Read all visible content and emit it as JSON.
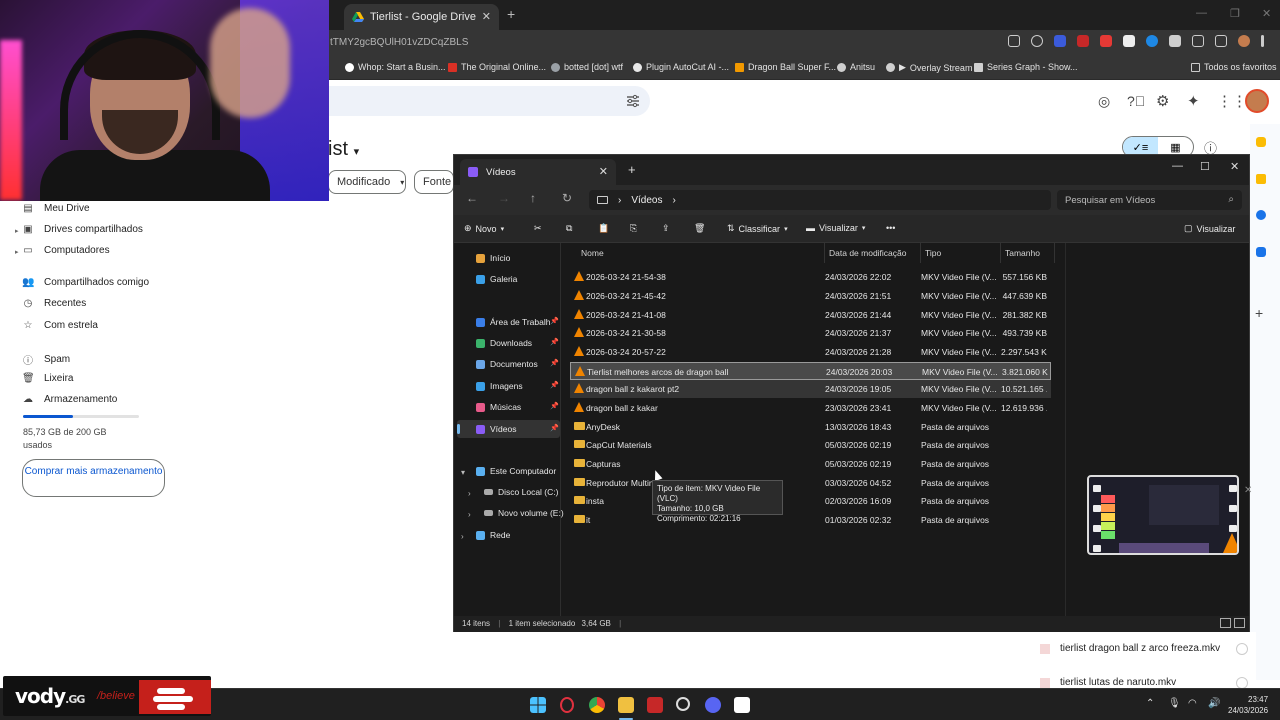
{
  "browser": {
    "tab_title": "Tierlist - Google Drive",
    "url": "tTMY2gcBQUlH01vZDCqZBLS",
    "bookmarks": [
      {
        "label": "Whop: Start a Busin...",
        "color": "#ffffff"
      },
      {
        "label": "The Original Online...",
        "color": "#d93025"
      },
      {
        "label": "botted [dot] wtf",
        "color": "#9aa0a6"
      },
      {
        "label": "Plugin AutoCut AI -...",
        "color": "#e8e8e8"
      },
      {
        "label": "Dragon Ball Super F...",
        "color": "#f29900"
      },
      {
        "label": "Anitsu",
        "color": "#cfcfcf"
      },
      {
        "label": "Overlay Stream",
        "color": "#cfcfcf"
      },
      {
        "label": "Series Graph - Show...",
        "color": "#cfcfcf"
      }
    ],
    "favorites_label": "Todos os favoritos"
  },
  "drive": {
    "heading_fragment": "ist",
    "filters": {
      "modified": "Modificado",
      "source": "Fonte"
    },
    "sidebar": [
      {
        "label": "Meu Drive",
        "icon": "drive-icon",
        "expand": true
      },
      {
        "label": "Drives compartilhados",
        "icon": "shared-drives-icon",
        "expand": true
      },
      {
        "label": "Computadores",
        "icon": "computer-icon",
        "expand": true
      },
      {
        "label": "Compartilhados comigo",
        "icon": "people-icon",
        "expand": false
      },
      {
        "label": "Recentes",
        "icon": "clock-icon",
        "expand": false
      },
      {
        "label": "Com estrela",
        "icon": "star-icon",
        "expand": false
      },
      {
        "label": "Spam",
        "icon": "spam-icon",
        "expand": false
      },
      {
        "label": "Lixeira",
        "icon": "trash-icon",
        "expand": false
      },
      {
        "label": "Armazenamento",
        "icon": "cloud-icon",
        "expand": false
      }
    ],
    "storage": {
      "text": "85,73 GB de 200 GB usados",
      "fraction": 0.43
    },
    "buy_button": "Comprar mais armazenamento",
    "uploads": [
      "tierlist dragon ball z arco freeza.mkv",
      "tierlist lutas de naruto.mkv"
    ]
  },
  "explorer": {
    "tab_title": "Vídeos",
    "breadcrumb": "Vídeos",
    "search_placeholder": "Pesquisar em Vídeos",
    "commands": {
      "new": "Novo",
      "sort": "Classificar",
      "view": "Visualizar",
      "details": "Visualizar"
    },
    "nav": [
      {
        "label": "Início",
        "color": "#e6a23c"
      },
      {
        "label": "Galeria",
        "color": "#3aa0e8"
      },
      {
        "label": "Área de Trabalho",
        "color": "#3a7ee8",
        "pinned": true
      },
      {
        "label": "Downloads",
        "color": "#3bb36b",
        "pinned": true
      },
      {
        "label": "Documentos",
        "color": "#6aa6e8",
        "pinned": true
      },
      {
        "label": "Imagens",
        "color": "#3aa0e8",
        "pinned": true
      },
      {
        "label": "Músicas",
        "color": "#e85a8a",
        "pinned": true
      },
      {
        "label": "Vídeos",
        "color": "#8a5cf6",
        "pinned": true
      },
      {
        "label": "Este Computador",
        "color": "#5ab0f0"
      },
      {
        "label": "Disco Local (C:)",
        "color": "#aaaaaa"
      },
      {
        "label": "Novo volume (E:)",
        "color": "#aaaaaa"
      },
      {
        "label": "Rede",
        "color": "#5ab0f0"
      }
    ],
    "columns": {
      "name": "Nome",
      "modified": "Data de modificação",
      "type": "Tipo",
      "size": "Tamanho"
    },
    "files": [
      {
        "name": "2026-03-24 21-54-38",
        "date": "24/03/2026 22:02",
        "type": "MKV Video File (V...",
        "size": "557.156 KB",
        "kind": "video"
      },
      {
        "name": "2026-03-24 21-45-42",
        "date": "24/03/2026 21:51",
        "type": "MKV Video File (V...",
        "size": "447.639 KB",
        "kind": "video"
      },
      {
        "name": "2026-03-24 21-41-08",
        "date": "24/03/2026 21:44",
        "type": "MKV Video File (V...",
        "size": "281.382 KB",
        "kind": "video"
      },
      {
        "name": "2026-03-24 21-30-58",
        "date": "24/03/2026 21:37",
        "type": "MKV Video File (V...",
        "size": "493.739 KB",
        "kind": "video"
      },
      {
        "name": "2026-03-24 20-57-22",
        "date": "24/03/2026 21:28",
        "type": "MKV Video File (V...",
        "size": "2.297.543 KB",
        "kind": "video"
      },
      {
        "name": "Tierlist melhores arcos de dragon ball",
        "date": "24/03/2026 20:03",
        "type": "MKV Video File (V...",
        "size": "3.821.060 KB",
        "kind": "video"
      },
      {
        "name": "dragon ball z kakarot pt2",
        "date": "24/03/2026 19:05",
        "type": "MKV Video File (V...",
        "size": "10.521.165 ...",
        "kind": "video"
      },
      {
        "name": "dragon ball z kakar",
        "date": "23/03/2026 23:41",
        "type": "MKV Video File (V...",
        "size": "12.619.936 ...",
        "kind": "video"
      },
      {
        "name": "AnyDesk",
        "date": "13/03/2026 18:43",
        "type": "Pasta de arquivos",
        "size": "",
        "kind": "folder"
      },
      {
        "name": "CapCut Materials",
        "date": "05/03/2026 02:19",
        "type": "Pasta de arquivos",
        "size": "",
        "kind": "folder"
      },
      {
        "name": "Capturas",
        "date": "05/03/2026 02:19",
        "type": "Pasta de arquivos",
        "size": "",
        "kind": "folder"
      },
      {
        "name": "Reprodutor Multimídia",
        "date": "03/03/2026 04:52",
        "type": "Pasta de arquivos",
        "size": "",
        "kind": "folder"
      },
      {
        "name": "insta",
        "date": "02/03/2026 16:09",
        "type": "Pasta de arquivos",
        "size": "",
        "kind": "folder"
      },
      {
        "name": "it",
        "date": "01/03/2026 02:32",
        "type": "Pasta de arquivos",
        "size": "",
        "kind": "folder"
      }
    ],
    "tooltip": [
      "Tipo de item: MKV Video File (VLC)",
      "Tamanho: 10,0 GB",
      "Comprimento: 02:21:16"
    ],
    "status": {
      "count": "14 itens",
      "selected": "1 item selecionado",
      "size": "3,64 GB"
    }
  },
  "taskbar": {
    "time": "23:47",
    "date": "24/03/2026"
  },
  "overlay": {
    "brand": "vody",
    "brand_suffix": ".GG",
    "tagline": "/believe"
  }
}
